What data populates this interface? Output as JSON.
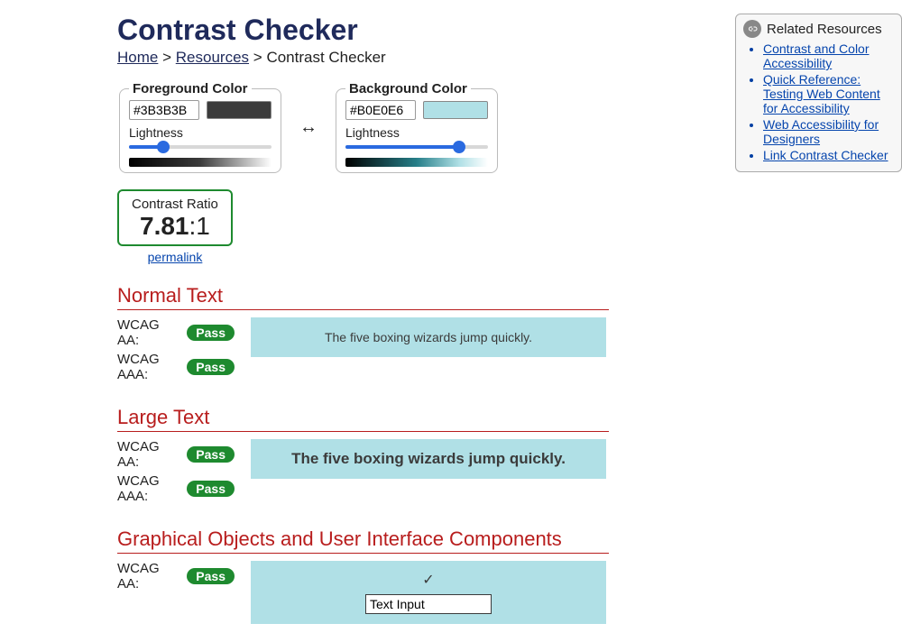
{
  "page": {
    "title": "Contrast Checker",
    "breadcrumb": {
      "home": "Home",
      "resources": "Resources",
      "current": "Contrast Checker",
      "sep": ">"
    }
  },
  "sidebar": {
    "title": "Related Resources",
    "links": [
      "Contrast and Color Accessibility",
      "Quick Reference: Testing Web Content for Accessibility",
      "Web Accessibility for Designers",
      "Link Contrast Checker"
    ]
  },
  "foreground": {
    "legend": "Foreground Color",
    "hex": "#3B3B3B",
    "swatch_color": "#3b3b3b",
    "lightness_label": "Lightness",
    "lightness_pct": 24,
    "gradient": "linear-gradient(to right,#000 0%,#3b3b3b 50%,#fff 100%)"
  },
  "background": {
    "legend": "Background Color",
    "hex": "#B0E0E6",
    "swatch_color": "#b0e0e6",
    "lightness_label": "Lightness",
    "lightness_pct": 80,
    "gradient": "linear-gradient(to right,#000 0%,#277f89 50%,#b0e0e6 80%,#fff 100%)"
  },
  "swap_glyph": "↔",
  "ratio": {
    "label": "Contrast Ratio",
    "value_bold": "7.81",
    "value_rest": ":1",
    "permalink": "permalink"
  },
  "sections": {
    "normal": {
      "heading": "Normal Text",
      "sample": "The five boxing wizards jump quickly.",
      "aa_label": "WCAG AA:",
      "aaa_label": "WCAG AAA:",
      "aa_result": "Pass",
      "aaa_result": "Pass"
    },
    "large": {
      "heading": "Large Text",
      "sample": "The five boxing wizards jump quickly.",
      "aa_label": "WCAG AA:",
      "aaa_label": "WCAG AAA:",
      "aa_result": "Pass",
      "aaa_result": "Pass"
    },
    "ui": {
      "heading": "Graphical Objects and User Interface Components",
      "aa_label": "WCAG AA:",
      "aa_result": "Pass",
      "tick": "✓",
      "input_value": "Text Input"
    }
  }
}
